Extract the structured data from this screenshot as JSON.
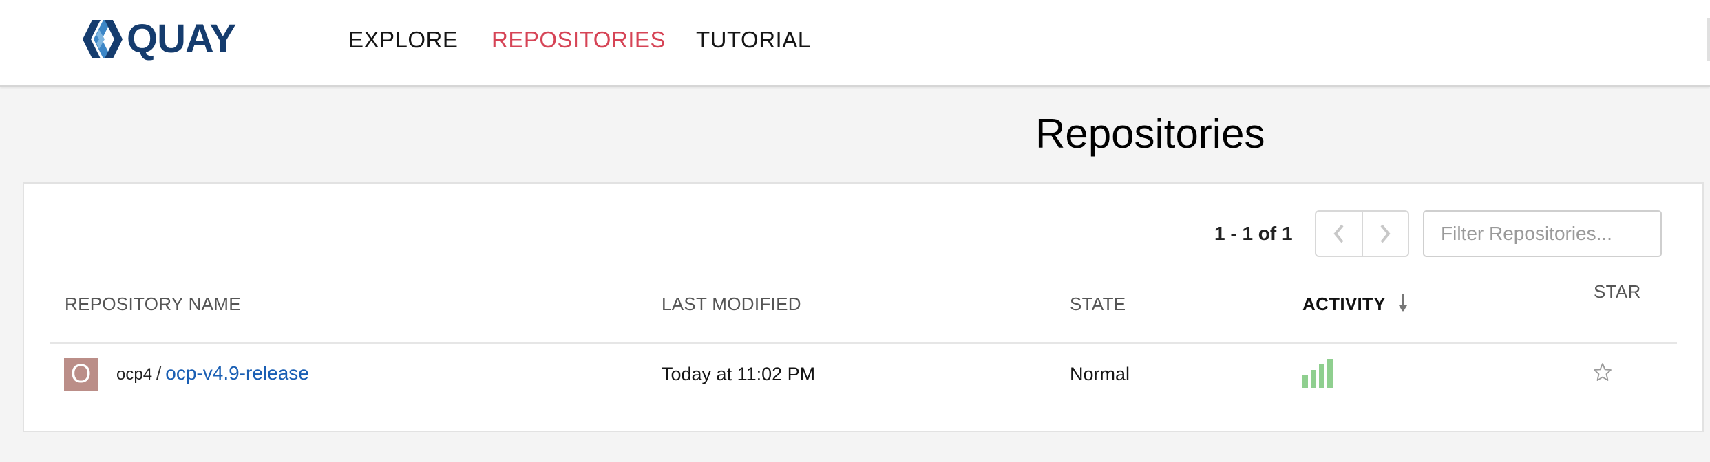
{
  "brand": {
    "name": "QUAY"
  },
  "nav": {
    "explore": "EXPLORE",
    "repositories": "REPOSITORIES",
    "tutorial": "TUTORIAL"
  },
  "page": {
    "title": "Repositories"
  },
  "pagination": {
    "range": "1 - 1 of 1"
  },
  "filter": {
    "placeholder": "Filter Repositories...",
    "value": ""
  },
  "table": {
    "headers": {
      "name": "REPOSITORY NAME",
      "modified": "LAST MODIFIED",
      "state": "STATE",
      "activity": "ACTIVITY",
      "star": "STAR"
    },
    "sort": {
      "column": "ACTIVITY",
      "direction": "descending"
    },
    "rows": [
      {
        "avatar_letter": "O",
        "namespace": "ocp4",
        "separator": "/",
        "name": "ocp-v4.9-release",
        "last_modified": "Today at 11:02 PM",
        "state": "Normal",
        "activity_level": 4,
        "starred": false
      }
    ]
  },
  "colors": {
    "brand": "#153c6e",
    "active_nav": "#d64456",
    "link": "#1a5fb4",
    "avatar": "#bb8e88",
    "activity": "#8fcf8f"
  }
}
